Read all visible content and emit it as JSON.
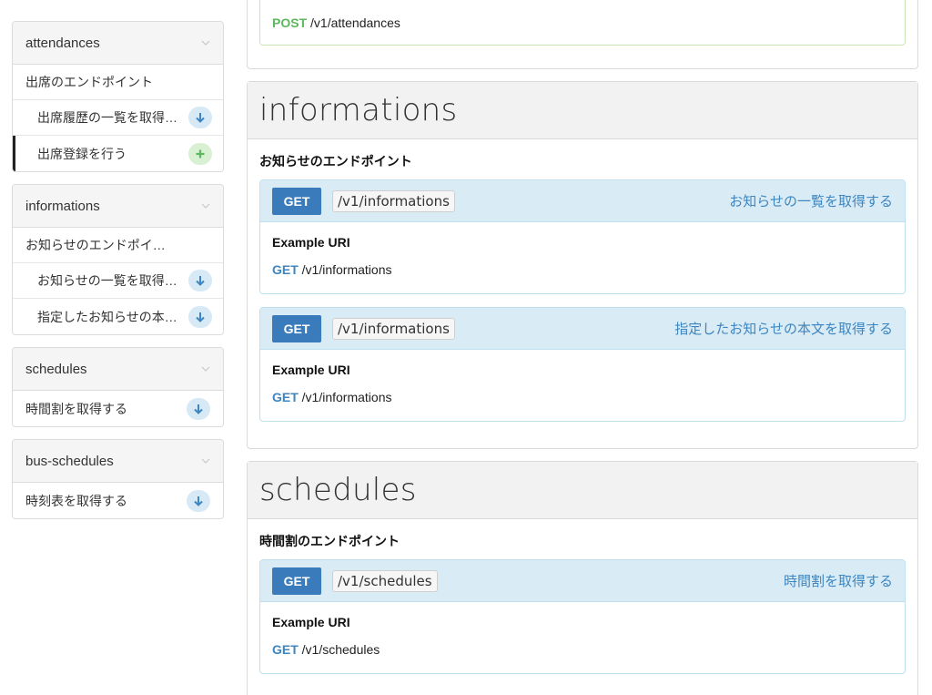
{
  "sidebar": {
    "sections": [
      {
        "title": "attendances",
        "desc": "出席のエンドポイント",
        "items": [
          {
            "label": "出席履歴の一覧を取得す...",
            "badge": "get"
          },
          {
            "label": "出席登録を行う",
            "badge": "post",
            "active": true
          }
        ]
      },
      {
        "title": "informations",
        "desc": "お知らせのエンドポイント",
        "items": [
          {
            "label": "お知らせの一覧を取得す...",
            "badge": "get"
          },
          {
            "label": "指定したお知らせの本文...",
            "badge": "get"
          }
        ]
      },
      {
        "title": "schedules",
        "items": [
          {
            "label": "時間割を取得する",
            "badge": "get"
          }
        ]
      },
      {
        "title": "bus-schedules",
        "items": [
          {
            "label": "時刻表を取得する",
            "badge": "get"
          }
        ]
      }
    ]
  },
  "main": {
    "top_partial": {
      "method": "POST",
      "path": "/v1/attendances"
    },
    "groups": [
      {
        "title": "informations",
        "desc": "お知らせのエンドポイント",
        "endpoints": [
          {
            "method": "GET",
            "path": "/v1/informations",
            "title": "お知らせの一覧を取得する",
            "example_label": "Example URI",
            "example_method": "GET",
            "example_path": " /v1/informations"
          },
          {
            "method": "GET",
            "path": "/v1/informations",
            "title": "指定したお知らせの本文を取得する",
            "example_label": "Example URI",
            "example_method": "GET",
            "example_path": " /v1/informations"
          }
        ]
      },
      {
        "title": "schedules",
        "desc": "時間割のエンドポイント",
        "endpoints": [
          {
            "method": "GET",
            "path": "/v1/schedules",
            "title": "時間割を取得する",
            "example_label": "Example URI",
            "example_method": "GET",
            "example_path": " /v1/schedules"
          }
        ]
      }
    ]
  },
  "colors": {
    "accent": "#3d86c1",
    "method_button": "#3a7bbb",
    "post_green": "#5cb85c"
  },
  "icons": {
    "collapse": "chevron-down-icon",
    "get": "arrow-down-icon",
    "post": "plus-icon"
  }
}
